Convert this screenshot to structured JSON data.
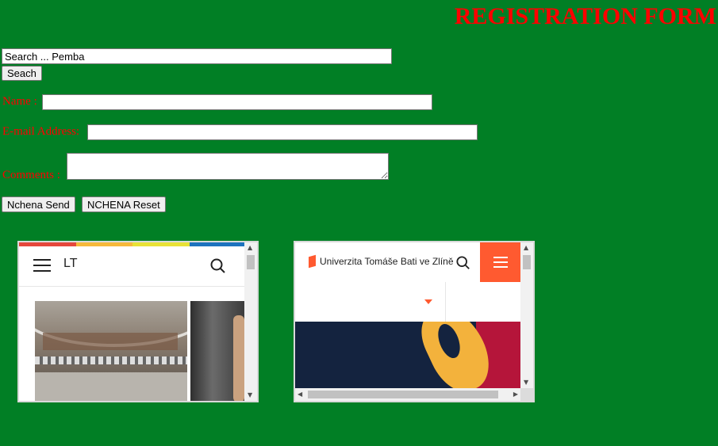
{
  "page": {
    "title": "REGISTRATION FORM",
    "background_color": "#017f25",
    "accent_color": "#ff0000"
  },
  "search": {
    "value": "Search ... Pemba",
    "button_label": "Seach"
  },
  "form": {
    "name_label": "Name :",
    "name_value": "",
    "email_label": "E-mail Address:",
    "email_value": "",
    "comments_label": "Comments :",
    "comments_value": "",
    "send_label": "Nchena Send",
    "reset_label": "NCHENA Reset"
  },
  "frame1": {
    "brand": "LT",
    "menu_icon": "hamburger-menu-icon",
    "search_icon": "search-icon",
    "stripe_colors": [
      "#e5473c",
      "#f6b93b",
      "#e8e236",
      "#1e73be"
    ]
  },
  "frame2": {
    "brand": "Univerzita Tomáše Bati ve Zlíně",
    "logo_icon": "utb-logo-icon",
    "search_icon": "search-icon",
    "menu_icon": "hamburger-menu-icon",
    "accent_color": "#ff5a30",
    "dropdown_icon": "caret-down-icon"
  }
}
